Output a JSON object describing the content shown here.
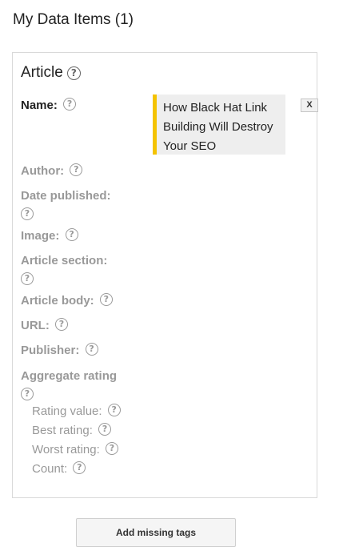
{
  "header": {
    "title": "My Data Items (1)"
  },
  "item": {
    "type": "Article",
    "help_glyph": "?",
    "name": {
      "label": "Name:",
      "value": "How Black Hat Link Building Will Destroy Your SEO",
      "remove_label": "X"
    },
    "properties": [
      {
        "label": "Author:"
      },
      {
        "label": "Date published:"
      },
      {
        "label": "Image:"
      },
      {
        "label": "Article section:"
      },
      {
        "label": "Article body:"
      },
      {
        "label": "URL:"
      },
      {
        "label": "Publisher:"
      },
      {
        "label": "Aggregate rating"
      }
    ],
    "aggregate_rating": [
      {
        "label": "Rating value:"
      },
      {
        "label": "Best rating:"
      },
      {
        "label": "Worst rating:"
      },
      {
        "label": "Count:"
      }
    ]
  },
  "footer": {
    "add_button_label": "Add missing tags"
  },
  "colors": {
    "accent": "#f4c300",
    "value_background": "#eeeeee",
    "empty_label": "#999999"
  }
}
